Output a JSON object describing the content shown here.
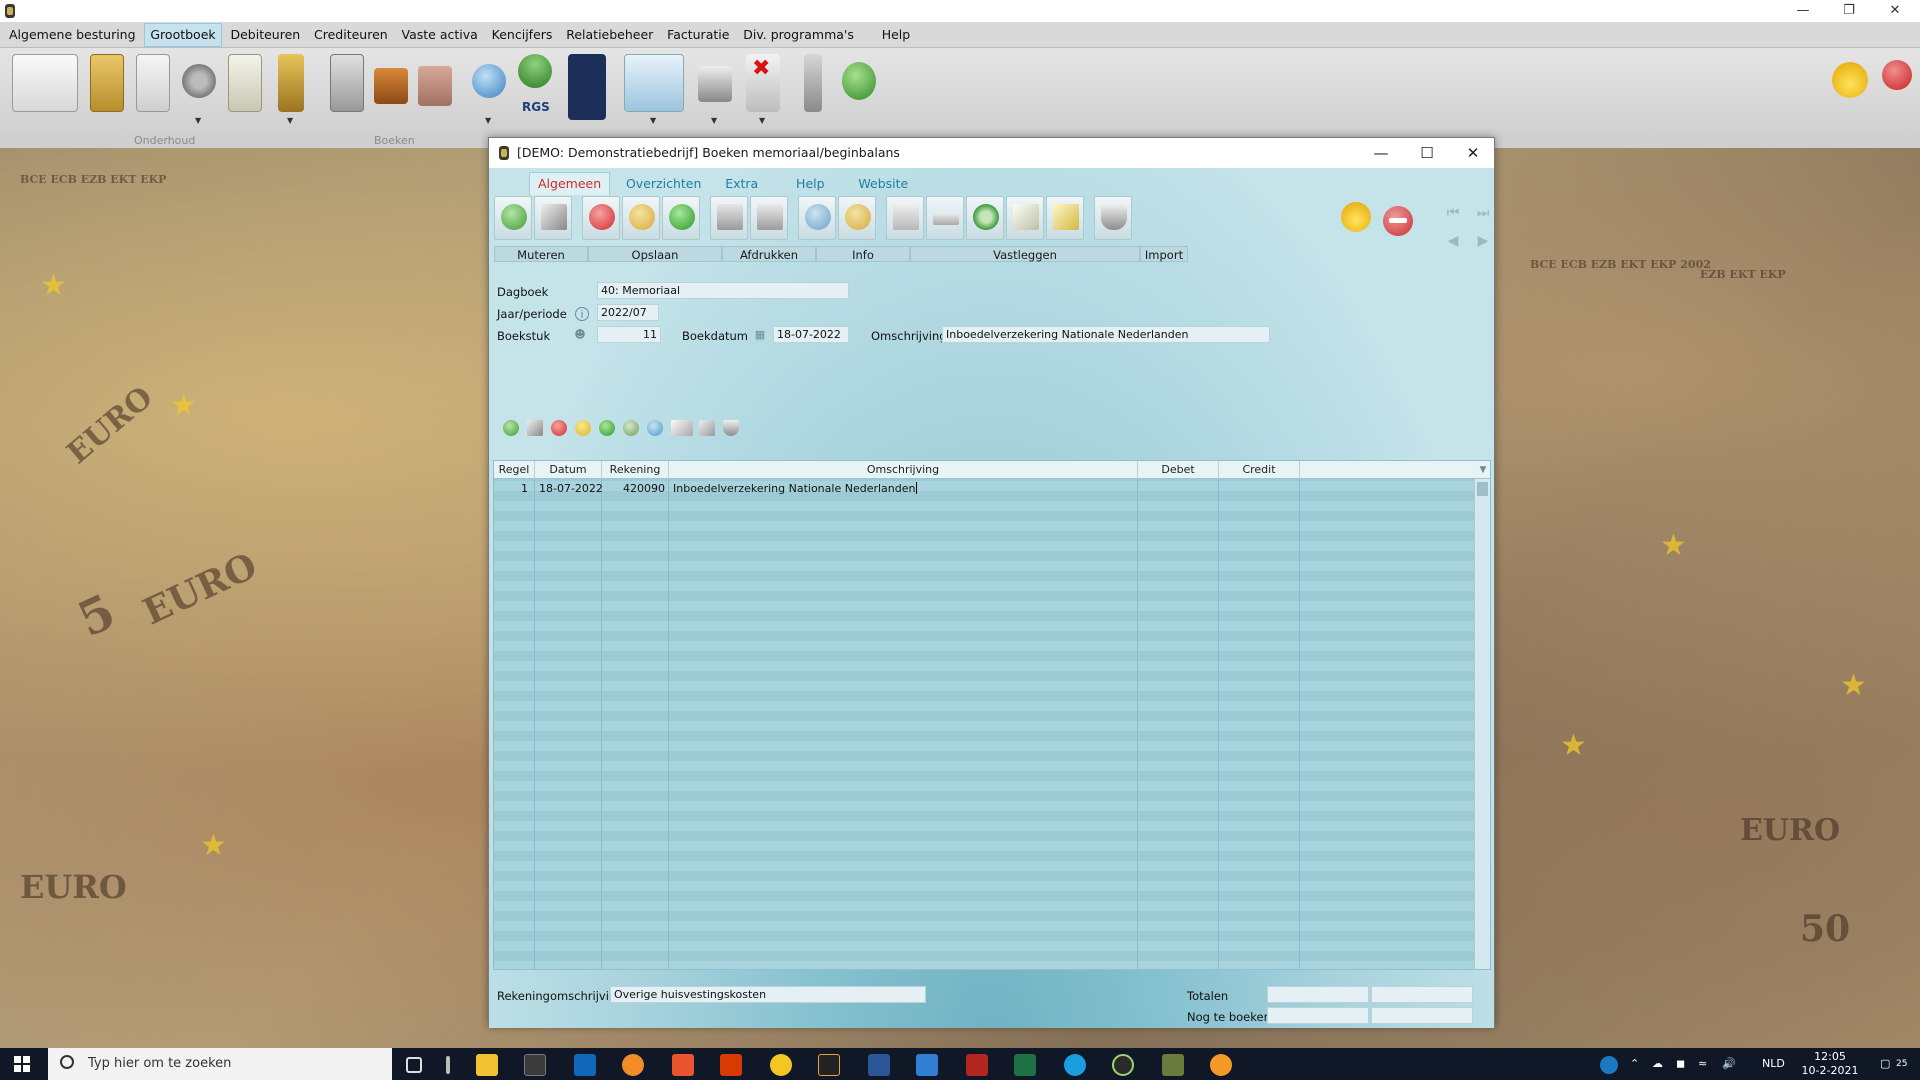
{
  "menu": {
    "items": [
      "Algemene besturing",
      "Grootboek",
      "Debiteuren",
      "Crediteuren",
      "Vaste activa",
      "Kencijfers",
      "Relatiebeheer",
      "Facturatie",
      "Div. programma's",
      "Help"
    ],
    "active_index": 1
  },
  "toolbar": {
    "groups": [
      "Onderhoud",
      "Boeken"
    ],
    "rgs_label": "RGS"
  },
  "dialog": {
    "title": "[DEMO: Demonstratiebedrijf]  Boeken memoriaal/beginbalans",
    "tabs": [
      "Algemeen",
      "Overzichten",
      "Extra",
      "Help",
      "Website"
    ],
    "active_tab": 0,
    "toolbar_groups": [
      "Muteren",
      "Opslaan",
      "Afdrukken",
      "Info",
      "Vastleggen",
      "Import"
    ]
  },
  "form": {
    "dagboek_label": "Dagboek",
    "dagboek_value": "40: Memoriaal",
    "jaar_label": "Jaar/periode",
    "jaar_value": "2022/07",
    "boekstuk_label": "Boekstuk",
    "boekstuk_value": "11",
    "boekdatum_label": "Boekdatum",
    "boekdatum_value": "18-07-2022",
    "omschrijving_label": "Omschrijving",
    "omschrijving_value": "Inboedelverzekering Nationale Nederlanden"
  },
  "grid": {
    "columns": [
      "Regel",
      "Datum",
      "Rekening",
      "Omschrijving",
      "Debet",
      "Credit"
    ],
    "rows": [
      {
        "regel": "1",
        "datum": "18-07-2022",
        "rekening": "420090",
        "omschrijving": "Inboedelverzekering Nationale Nederlanden",
        "debet": "",
        "credit": ""
      }
    ]
  },
  "footer": {
    "rekeningomschrijving_label": "Rekeningomschrijving",
    "rekeningomschrijving_value": "Overige huisvestingskosten",
    "totalen_label": "Totalen",
    "nog_te_boeken_label": "Nog te boeken"
  },
  "background_bills": {
    "texts": [
      "EURO",
      "5",
      "EURO",
      "EURO",
      "EURO",
      "BCE ECB EZB EKT EKP",
      "BCE ECB EZB EKT EKP 2002",
      "EZB EKT EKP",
      "50"
    ]
  },
  "taskbar": {
    "search_placeholder": "Typ hier om te zoeken",
    "language": "NLD",
    "time": "12:05",
    "date": "10-2-2021",
    "notifications": "25"
  }
}
